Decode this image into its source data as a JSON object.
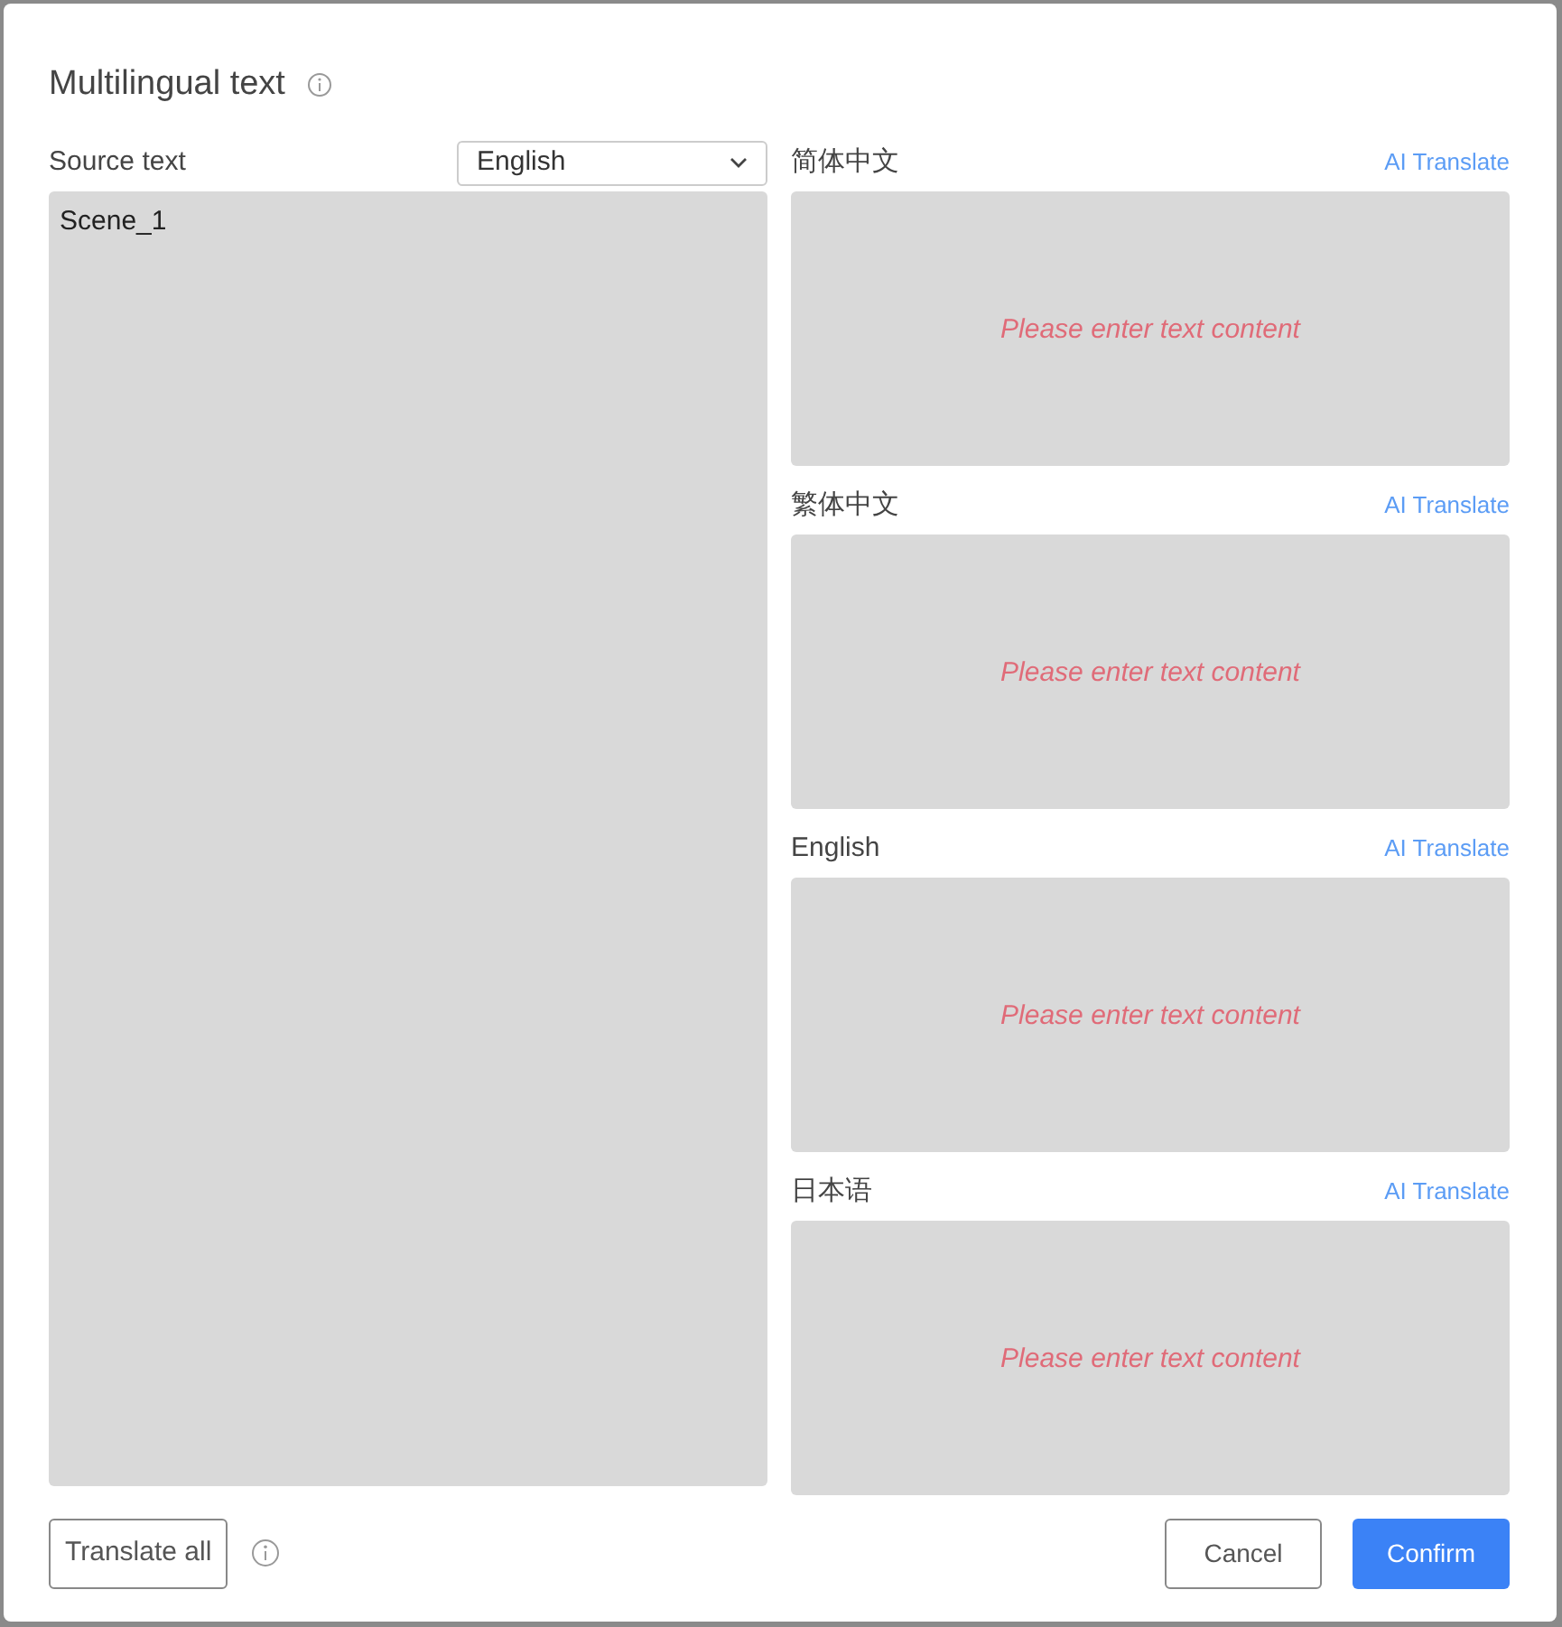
{
  "dialog": {
    "title": "Multilingual text"
  },
  "source": {
    "label": "Source text",
    "language": "English",
    "value": "Scene_1"
  },
  "translations": [
    {
      "language": "简体中文",
      "action": "AI Translate",
      "placeholder": "Please enter text content"
    },
    {
      "language": "繁体中文",
      "action": "AI Translate",
      "placeholder": "Please enter text content"
    },
    {
      "language": "English",
      "action": "AI Translate",
      "placeholder": "Please enter text content"
    },
    {
      "language": "日本语",
      "action": "AI Translate",
      "placeholder": "Please enter text content"
    }
  ],
  "footer": {
    "translate_all": "Translate all",
    "cancel": "Cancel",
    "confirm": "Confirm"
  }
}
